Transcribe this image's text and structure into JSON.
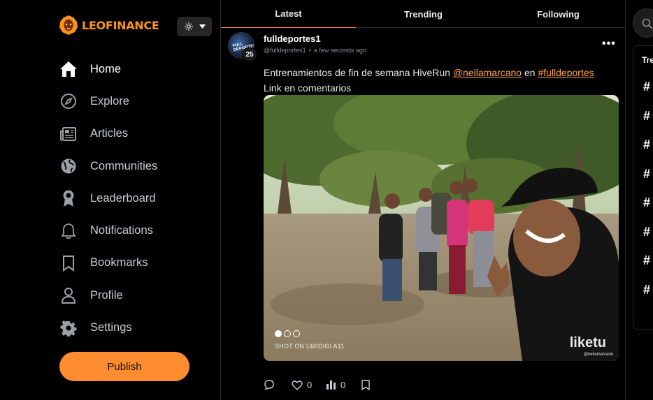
{
  "logo": {
    "text_a": "LEO",
    "text_b": "FINANCE"
  },
  "nav": {
    "items": [
      {
        "label": "Home",
        "icon": "home-icon"
      },
      {
        "label": "Explore",
        "icon": "compass-icon"
      },
      {
        "label": "Articles",
        "icon": "newspaper-icon"
      },
      {
        "label": "Communities",
        "icon": "globe-icon"
      },
      {
        "label": "Leaderboard",
        "icon": "award-icon"
      },
      {
        "label": "Notifications",
        "icon": "bell-icon"
      },
      {
        "label": "Bookmarks",
        "icon": "bookmark-icon"
      },
      {
        "label": "Profile",
        "icon": "user-icon"
      },
      {
        "label": "Settings",
        "icon": "gear-icon"
      }
    ],
    "publish_label": "Publish"
  },
  "tabs": [
    {
      "label": "Latest"
    },
    {
      "label": "Trending"
    },
    {
      "label": "Following"
    }
  ],
  "post": {
    "author": "fulldeportes1",
    "handle": "@fulldeportes1",
    "separator": "•",
    "time": "a few seconds ago",
    "reputation": "25",
    "avatar_text": "FULL DEPORTES",
    "text_before": "Entrenamientos de fin de semana HiveRun ",
    "mention": "@neilamarcano",
    "text_mid": " en ",
    "hashtag": "#fulldeportes",
    "text_line2": "Link en comentarios",
    "photo_caption": "SHOT ON UMIDIGI A11",
    "photo_brand": "liketu",
    "photo_brand_sub": "@neilamarcano",
    "likes": "0",
    "views": "0"
  },
  "right": {
    "trend_title": "Tre",
    "hash_items": [
      "#",
      "#",
      "#",
      "#",
      "#",
      "#",
      "#",
      "#"
    ]
  },
  "colors": {
    "accent": "#ff8c2f",
    "mention": "#ffa94d",
    "background": "#000000"
  }
}
